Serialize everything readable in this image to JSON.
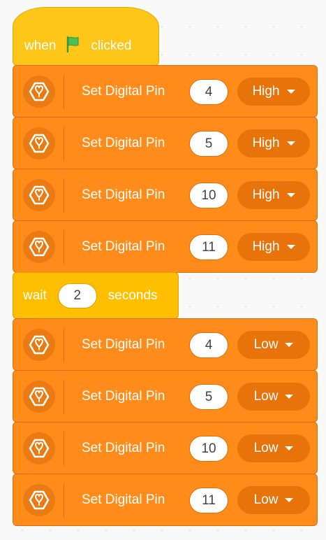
{
  "hat": {
    "word_when": "when",
    "word_clicked": "clicked",
    "flag_icon": "green-flag-icon",
    "flag_color": "#4cbf56"
  },
  "blocks_high": [
    {
      "label": "Set Digital Pin",
      "pin": "4",
      "state": "High"
    },
    {
      "label": "Set Digital Pin",
      "pin": "5",
      "state": "High"
    },
    {
      "label": "Set Digital Pin",
      "pin": "10",
      "state": "High"
    },
    {
      "label": "Set Digital Pin",
      "pin": "11",
      "state": "High"
    }
  ],
  "wait": {
    "word_wait": "wait",
    "value": "2",
    "word_seconds": "seconds"
  },
  "blocks_low": [
    {
      "label": "Set Digital Pin",
      "pin": "4",
      "state": "Low"
    },
    {
      "label": "Set Digital Pin",
      "pin": "5",
      "state": "Low"
    },
    {
      "label": "Set Digital Pin",
      "pin": "10",
      "state": "Low"
    },
    {
      "label": "Set Digital Pin",
      "pin": "11",
      "state": "Low"
    }
  ],
  "colors": {
    "hat_yellow": "#ffc61a",
    "command_orange": "#ff8c1a",
    "dropdown_orange": "#e8730a",
    "text": "#ffffff"
  },
  "icons": {
    "extension": "extension-logo-icon",
    "dropdown": "caret-down-icon"
  }
}
